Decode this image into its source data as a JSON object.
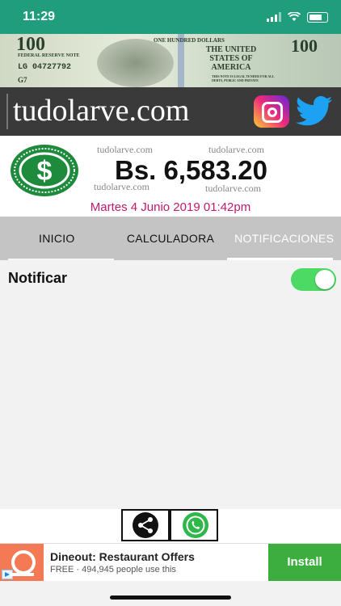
{
  "status_bar": {
    "time": "11:29"
  },
  "banner": {
    "bill": {
      "denomination": "100",
      "header": "ONE HUNDRED DOLLARS",
      "reserve": "FEDERAL RESERVE NOTE",
      "serial": "LG 04727792",
      "country": "THE UNITED STATES OF AMERICA",
      "legal": "THIS NOTE IS LEGAL TENDER FOR ALL DEBTS, PUBLIC AND PRIVATE",
      "code": "G7"
    },
    "site_name": "tudolarve.com",
    "social_icons": [
      "instagram-icon",
      "twitter-icon"
    ],
    "twitter_color": "#1da1f2"
  },
  "rate": {
    "watermark": "tudolarve.com",
    "price": "Bs. 6,583.20",
    "datetime": "Martes 4 Junio 2019 01:42pm",
    "coin_icon": "dollar-coin-icon",
    "coin_color": "#1e8a3c",
    "date_color": "#c2186b"
  },
  "tabs": [
    {
      "label": "INICIO",
      "active": false
    },
    {
      "label": "CALCULADORA",
      "active": false
    },
    {
      "label": "NOTIFICACIONES",
      "active": true
    }
  ],
  "settings": {
    "notify_label": "Notificar",
    "notify_enabled": true,
    "toggle_color": "#4cd964"
  },
  "share": {
    "buttons": [
      "share-icon",
      "whatsapp-icon"
    ]
  },
  "ad": {
    "title": "Dineout: Restaurant Offers",
    "subtitle": "FREE · 494,945 people use this",
    "install_label": "Install",
    "install_color": "#3cae3f"
  }
}
